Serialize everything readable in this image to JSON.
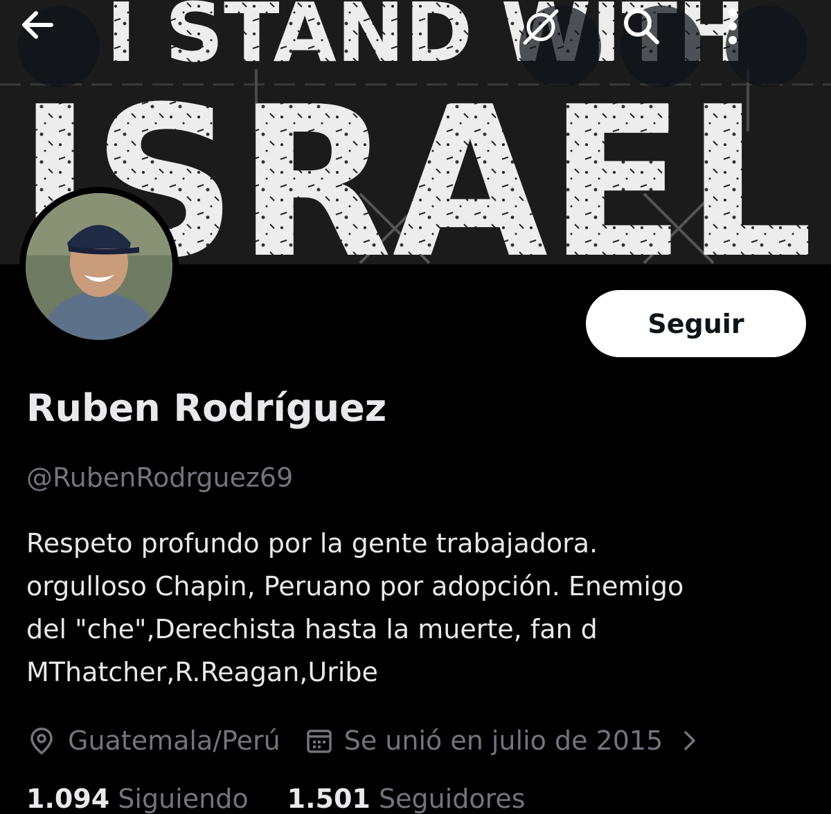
{
  "banner": {
    "line1": "I STAND WITH",
    "line2": "ISRAEL"
  },
  "topbar": {
    "back_icon": "back-arrow-icon",
    "grok_icon": "slash-circle-icon",
    "search_icon": "search-icon",
    "more_icon": "more-vertical-icon"
  },
  "profile": {
    "name": "Ruben Rodríguez",
    "handle": "@RubenRodrguez69",
    "follow_label": "Seguir",
    "bio_lines": [
      "Respeto profundo por la gente trabajadora.",
      "orgulloso Chapin, Peruano por adopción. Enemigo",
      "del \"che\",Derechista hasta la muerte, fan d",
      "MThatcher,R.Reagan,Uribe"
    ],
    "location": "Guatemala/Perú",
    "joined": "Se unió en julio de 2015",
    "following_count": "1.094",
    "following_label": "Siguiendo",
    "followers_count": "1.501",
    "followers_label": "Seguidores"
  },
  "colors": {
    "background": "#000000",
    "text": "#e7e9ea",
    "secondary": "#71767b",
    "button_bg": "#ffffff"
  }
}
